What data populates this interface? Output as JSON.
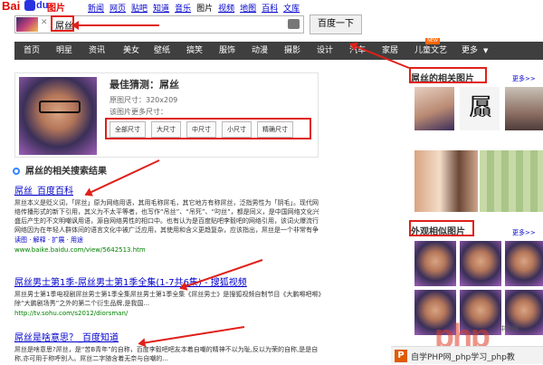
{
  "logo": {
    "bai": "Bai",
    "du": "du",
    "tu": "图片"
  },
  "topnav": [
    "新闻",
    "网页",
    "贴吧",
    "知道",
    "音乐",
    "图片",
    "视频",
    "地图",
    "百科",
    "文库"
  ],
  "search": {
    "query": "屌丝",
    "button": "百度一下"
  },
  "categories": [
    "首页",
    "明星",
    "资讯",
    "美女",
    "壁纸",
    "搞笑",
    "服饰",
    "动漫",
    "摄影",
    "设计",
    "汽车",
    "家居",
    "儿童文艺",
    "更多"
  ],
  "new_badge": "NEW",
  "guess": {
    "title": "最佳猜测：屌丝",
    "size_label": "原图尺寸：320x209",
    "more_sizes_label": "该图片更多尺寸：",
    "sizes": [
      "全部尺寸",
      "大尺寸",
      "中尺寸",
      "小尺寸",
      "精确尺寸"
    ]
  },
  "related_search_title": "屌丝的相关搜索结果",
  "results": [
    {
      "title": "屌丝_百度百科",
      "body": "屌丝本义是贬义词，「屌丝」原为网络用语，其用毛称屌毛，其它地方有称屌丝，泛指男性为「阴毛」。现代网络传播形式的新下引用，其义为不太平等者，也写作“吊丝”、“吊死”、“叼丝”，都是同义，是中国网络文化兴盛后产生的不文明嘲讽用语，源自网络男性的相口中。也有认为是百度贴吧李毅吧的网络引用，该词火爆流行网络因为在年轻人群体间的语言文化中被广泛应用，其使用和含义更趋复杂，应该指出，屌丝是一个非常有争议的网络词语，屌丝文化不过是又一种网络亚...",
      "link": "www.baike.baidu.com/view/5642513.htm",
      "extra": "读图 · 解释 · 扩展 · 用途"
    },
    {
      "title": "屌丝男士第1季-屌丝男士第1季全集(1-7共6集) - 搜狐视频",
      "body": "屌丝男士第1季电视剧屌丝男士第1季全集屌丝男士第1季全集《屌丝男士》是搜狐视频自制节目《大鹏嘚吧嘚》除“大鹏剧场秀”之外的第二个衍生品牌,是我国...",
      "link": "http://tv.sohu.com/s2012/diorsman/",
      "extra": ""
    },
    {
      "title": "屌丝是啥意思？_百度知道",
      "body": "屌丝是啥意思?屌丝，是“苦B青年”的自称，百度李毅吧吧友本着自嘲的精神不以为耻,反以为荣的自称,是是自称,亦可用于称呼别人。屌丝二字随含着无奈与自嘲的...",
      "link": "",
      "extra": ""
    }
  ],
  "side": {
    "related_title": "屌丝的相关图片",
    "similar_title": "外观相似图片",
    "more": "更多>>"
  },
  "watermark": {
    "big": "php",
    "small": "中文网",
    "bar_logo": "P",
    "bar_text": "自学PHP网_php学习_php教"
  }
}
